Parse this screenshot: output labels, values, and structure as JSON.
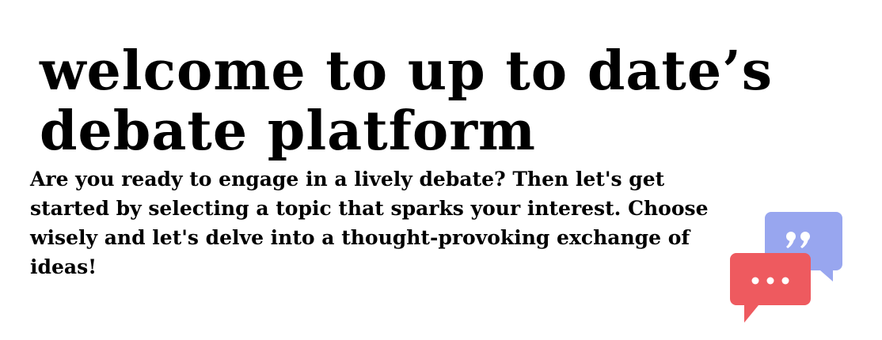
{
  "hero": {
    "title_line1": "welcome to up to date’s",
    "title_line2": "debate platform"
  },
  "intro": {
    "text": "Are you ready to engage in a lively debate? Then let's get started by selecting a topic that sparks your interest. Choose wisely and let's delve into a thought-provoking exchange of ideas!"
  },
  "illustration": {
    "icon": "chat-bubbles-icon",
    "front_bubble_color": "#ee5a5f",
    "back_bubble_color": "#98a6ef",
    "glyph_color": "#ffffff"
  }
}
